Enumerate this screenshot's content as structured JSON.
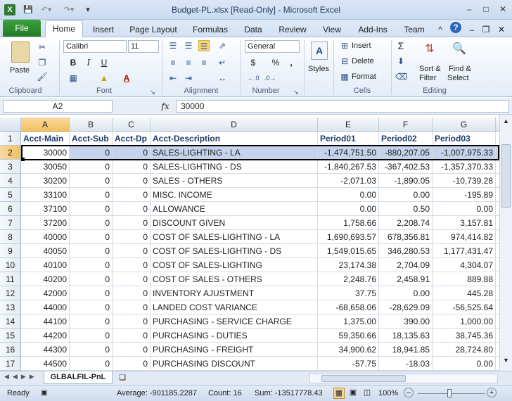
{
  "window": {
    "title": "Budget-PL.xlsx  [Read-Only]  -  Microsoft Excel"
  },
  "tabs": [
    "File",
    "Home",
    "Insert",
    "Page Layout",
    "Formulas",
    "Data",
    "Review",
    "View",
    "Add-Ins",
    "Team"
  ],
  "ribbon": {
    "paste": "Paste",
    "font_name": "Calibri",
    "font_size": "11",
    "number_format": "General",
    "styles": "Styles",
    "insert": "Insert",
    "delete": "Delete",
    "format": "Format",
    "sort_filter_1": "Sort &",
    "sort_filter_2": "Filter",
    "find_select_1": "Find &",
    "find_select_2": "Select",
    "groups": {
      "clipboard": "Clipboard",
      "font": "Font",
      "alignment": "Alignment",
      "number": "Number",
      "cells": "Cells",
      "editing": "Editing"
    },
    "bold": "B",
    "italic": "I",
    "underline": "U",
    "font_color": "A",
    "dollar": "$",
    "percent": "%",
    "comma": ","
  },
  "formula_bar": {
    "name_box": "A2",
    "fx": "fx",
    "value": "30000"
  },
  "columns": [
    "A",
    "B",
    "C",
    "D",
    "E",
    "F",
    "G"
  ],
  "header_row": [
    "Acct-Main",
    "Acct-Sub",
    "Acct-Dp",
    "Acct-Description",
    "Period01",
    "Period02",
    "Period03"
  ],
  "rows": [
    {
      "n": "2",
      "a": "30000",
      "b": "0",
      "c": "0",
      "d": "SALES-LIGHTING - LA",
      "e": "-1,474,751.50",
      "f": "-880,207.05",
      "g": "-1,007,975.33"
    },
    {
      "n": "3",
      "a": "30050",
      "b": "0",
      "c": "0",
      "d": "SALES-LIGHTING - DS",
      "e": "-1,840,267.53",
      "f": "-367,402.53",
      "g": "-1,357,370.33"
    },
    {
      "n": "4",
      "a": "30200",
      "b": "0",
      "c": "0",
      "d": "SALES - OTHERS",
      "e": "-2,071.03",
      "f": "-1,890.05",
      "g": "-10,739.28"
    },
    {
      "n": "5",
      "a": "33100",
      "b": "0",
      "c": "0",
      "d": "MISC. INCOME",
      "e": "0.00",
      "f": "0.00",
      "g": "-195.89"
    },
    {
      "n": "6",
      "a": "37100",
      "b": "0",
      "c": "0",
      "d": "ALLOWANCE",
      "e": "0.00",
      "f": "0.50",
      "g": "0.00"
    },
    {
      "n": "7",
      "a": "37200",
      "b": "0",
      "c": "0",
      "d": "DISCOUNT GIVEN",
      "e": "1,758.66",
      "f": "2,208.74",
      "g": "3,157.81"
    },
    {
      "n": "8",
      "a": "40000",
      "b": "0",
      "c": "0",
      "d": "COST OF SALES-LIGHTING - LA",
      "e": "1,690,693.57",
      "f": "678,356.81",
      "g": "974,414.82"
    },
    {
      "n": "9",
      "a": "40050",
      "b": "0",
      "c": "0",
      "d": "COST OF SALES-LIGHTING - DS",
      "e": "1,549,015.65",
      "f": "346,280.53",
      "g": "1,177,431.47"
    },
    {
      "n": "10",
      "a": "40100",
      "b": "0",
      "c": "0",
      "d": "COST OF SALES-LIGHTING",
      "e": "23,174.38",
      "f": "2,704.09",
      "g": "4,304.07"
    },
    {
      "n": "11",
      "a": "40200",
      "b": "0",
      "c": "0",
      "d": "COST OF SALES - OTHERS",
      "e": "2,248.76",
      "f": "2,458.91",
      "g": "889.88"
    },
    {
      "n": "12",
      "a": "42000",
      "b": "0",
      "c": "0",
      "d": "INVENTORY AJUSTMENT",
      "e": "37.75",
      "f": "0.00",
      "g": "445.28"
    },
    {
      "n": "13",
      "a": "44000",
      "b": "0",
      "c": "0",
      "d": "LANDED COST VARIANCE",
      "e": "-68,658.06",
      "f": "-28,629.09",
      "g": "-56,525.64"
    },
    {
      "n": "14",
      "a": "44100",
      "b": "0",
      "c": "0",
      "d": "PURCHASING - SERVICE CHARGE",
      "e": "1,375.00",
      "f": "390.00",
      "g": "1,000.00"
    },
    {
      "n": "15",
      "a": "44200",
      "b": "0",
      "c": "0",
      "d": "PURCHASING - DUTIES",
      "e": "59,350.66",
      "f": "18,135.63",
      "g": "38,745.36"
    },
    {
      "n": "16",
      "a": "44300",
      "b": "0",
      "c": "0",
      "d": "PURCHASING - FREIGHT",
      "e": "34,900.62",
      "f": "18,941.85",
      "g": "28,724.80"
    },
    {
      "n": "17",
      "a": "44500",
      "b": "0",
      "c": "0",
      "d": "PURCHASING DISCOUNT",
      "e": "-57.75",
      "f": "-18.03",
      "g": "0.00"
    }
  ],
  "sheet_tab": "GLBALFIL-PnL",
  "status": {
    "ready": "Ready",
    "average": "Average: -901185.2287",
    "count": "Count: 16",
    "sum": "Sum: -13517778.43",
    "zoom": "100%"
  }
}
